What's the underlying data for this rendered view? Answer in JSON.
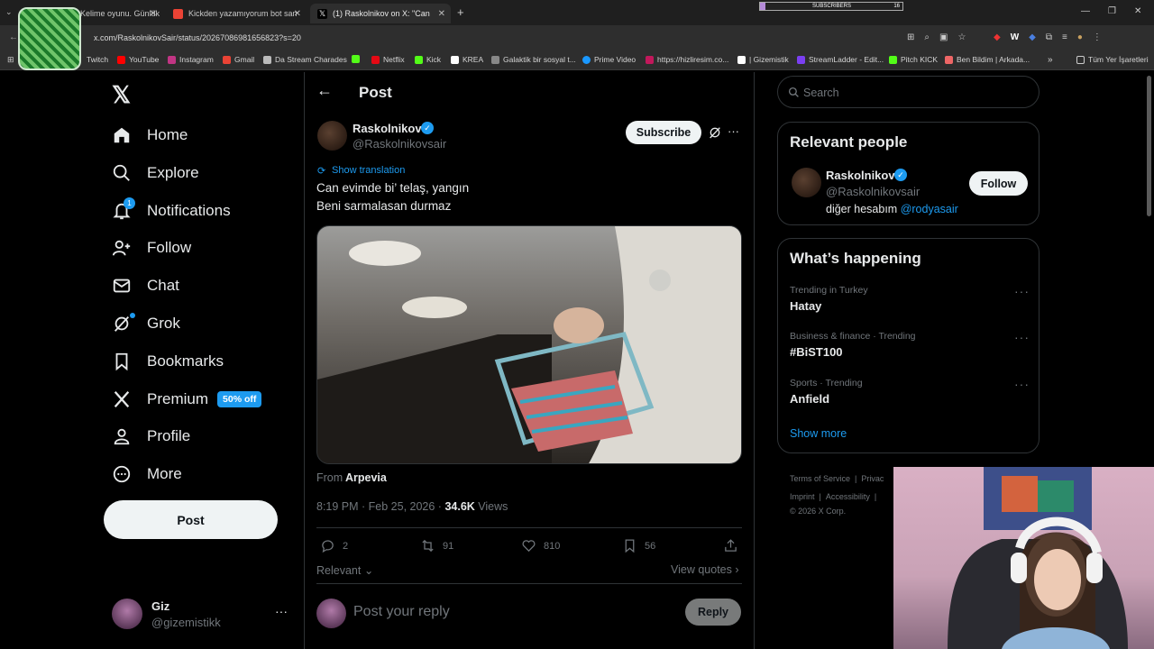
{
  "browser": {
    "tabs": [
      {
        "label": "Kelime oyunu. Günlük"
      },
      {
        "label": "Kickden yazamıyorum bot san"
      },
      {
        "label": "(1) Raskolnikov on X: \"Can"
      }
    ],
    "url": "x.com/RaskolnikovSair/status/2026708698165682​3?s=20",
    "bookmarks": [
      "Twitch",
      "YouTube",
      "Instagram",
      "Gmail",
      "Da Stream Charades",
      "Netflix",
      "Kick",
      "KREA",
      "Galaktik bir sosyal t...",
      "Prime Video",
      "https://hizliresim.co...",
      "| Gizemistik",
      "StreamLadder - Edit...",
      "Pitch KICK",
      "Ben Bildim | Arkada...",
      "Tüm Yer İşaretleri"
    ],
    "subscribers_label": "SUBSCRIBERS",
    "subscribers_count": "16",
    "subscribers_fraction": 0.04
  },
  "nav": {
    "items": [
      "Home",
      "Explore",
      "Notifications",
      "Follow",
      "Chat",
      "Grok",
      "Bookmarks",
      "Premium",
      "Profile",
      "More"
    ],
    "notification_count": "1",
    "premium_badge": "50% off",
    "post_button": "Post",
    "account": {
      "name": "Giz",
      "handle": "@gizemistikk"
    }
  },
  "main": {
    "header_title": "Post",
    "author": {
      "name": "Raskolnikov",
      "handle": "@Raskolnikovsair"
    },
    "subscribe_button": "Subscribe",
    "show_translation": "Show translation",
    "text_line1": "Can evimde bi’ telaş, yangın",
    "text_line2": "Beni sarmalasan durmaz",
    "from_label": "From",
    "from_source": "Arpevia",
    "timestamp": "8:19 PM · Feb 25, 2026 · ",
    "views_count": "34.6K",
    "views_label": " Views",
    "replies": "2",
    "reposts": "91",
    "likes": "810",
    "bookmarks": "56",
    "relevant_label": "Relevant",
    "view_quotes": "View quotes",
    "reply_placeholder": "Post your reply",
    "reply_button": "Reply"
  },
  "right": {
    "search_placeholder": "Search",
    "relevant_title": "Relevant people",
    "person": {
      "name": "Raskolnikov",
      "handle": "@Raskolnikovsair",
      "bio": "diğer hesabım ",
      "bio_link": "@rodyasair"
    },
    "follow_button": "Follow",
    "happening_title": "What’s happening",
    "trends": [
      {
        "meta": "Trending in Turkey",
        "name": "Hatay"
      },
      {
        "meta": "Business & finance · Trending",
        "name": "#BiST100"
      },
      {
        "meta": "Sports · Trending",
        "name": "Anfield"
      }
    ],
    "show_more": "Show more",
    "footer": {
      "terms": "Terms of Service",
      "privacy": "Privac",
      "imprint": "Imprint",
      "accessibility": "Accessibility",
      "copyright": "© 2026 X Corp."
    }
  },
  "colors": {
    "accent": "#1d9bf0",
    "bg": "#000000",
    "border": "#2f3336",
    "muted": "#71767b"
  }
}
